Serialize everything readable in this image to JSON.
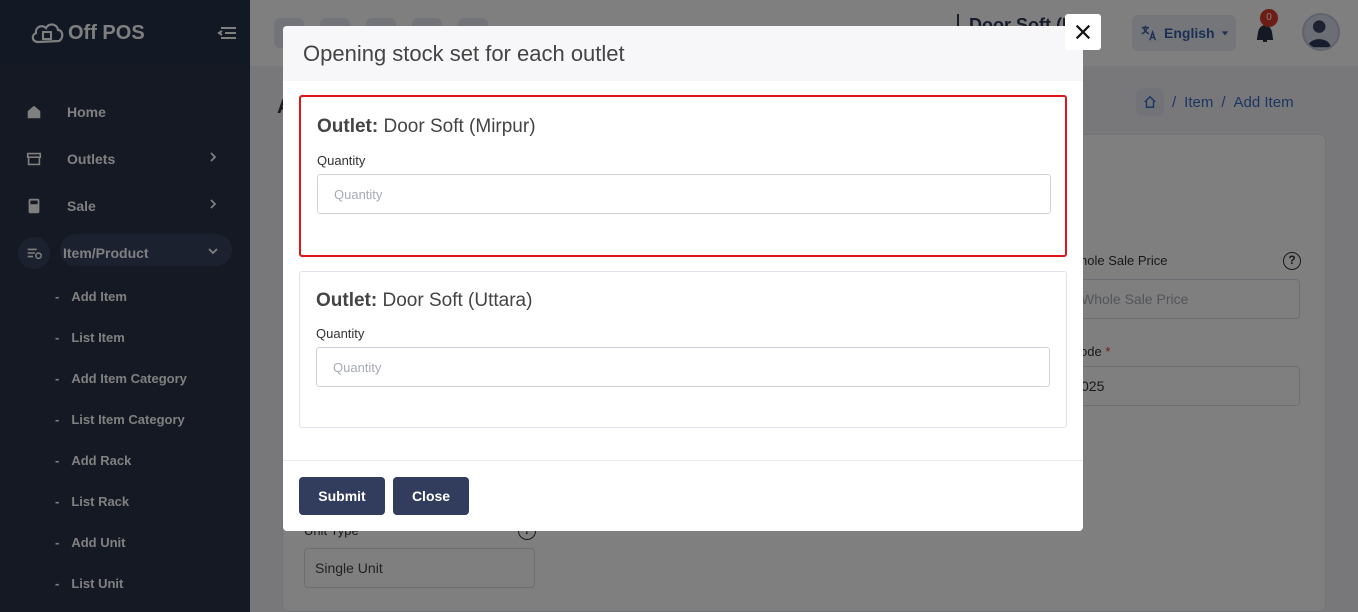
{
  "app": {
    "logo_text": "Off POS"
  },
  "sidebar": {
    "items": [
      {
        "label": "Home",
        "icon": "home-icon"
      },
      {
        "label": "Outlets",
        "icon": "store-icon"
      },
      {
        "label": "Sale",
        "icon": "calculator-icon"
      },
      {
        "label": "Item/Product",
        "icon": "list-icon"
      }
    ],
    "subitems": [
      {
        "label": "Add Item"
      },
      {
        "label": "List Item"
      },
      {
        "label": "Add Item Category"
      },
      {
        "label": "List Item Category"
      },
      {
        "label": "Add Rack"
      },
      {
        "label": "List Rack"
      },
      {
        "label": "Add Unit"
      },
      {
        "label": "List Unit"
      }
    ]
  },
  "header": {
    "outlet_name": "Door Soft (U",
    "language": "English",
    "notification_count": "0"
  },
  "breadcrumb": {
    "items": [
      "Item",
      "Add Item"
    ]
  },
  "background_form": {
    "page_title_fragment": "A",
    "whole_sale_label": "hole Sale Price",
    "whole_sale_placeholder": "Whole Sale Price",
    "code_label": "ode",
    "code_value": "025",
    "unit_type_label": "Unit Type",
    "unit_type_value": "Single Unit"
  },
  "modal": {
    "title": "Opening stock set for each outlet",
    "outlets": [
      {
        "prefix": "Outlet:",
        "name": "Door Soft (Mirpur)",
        "quantity_label": "Quantity",
        "quantity_placeholder": "Quantity",
        "quantity_value": ""
      },
      {
        "prefix": "Outlet:",
        "name": "Door Soft (Uttara)",
        "quantity_label": "Quantity",
        "quantity_placeholder": "Quantity",
        "quantity_value": ""
      }
    ],
    "submit_label": "Submit",
    "close_label": "Close"
  },
  "colors": {
    "sidebar_bg": "#2a3349",
    "button_bg": "#323d5e",
    "highlight_border": "#e0141b",
    "link": "#3a6bc7"
  }
}
